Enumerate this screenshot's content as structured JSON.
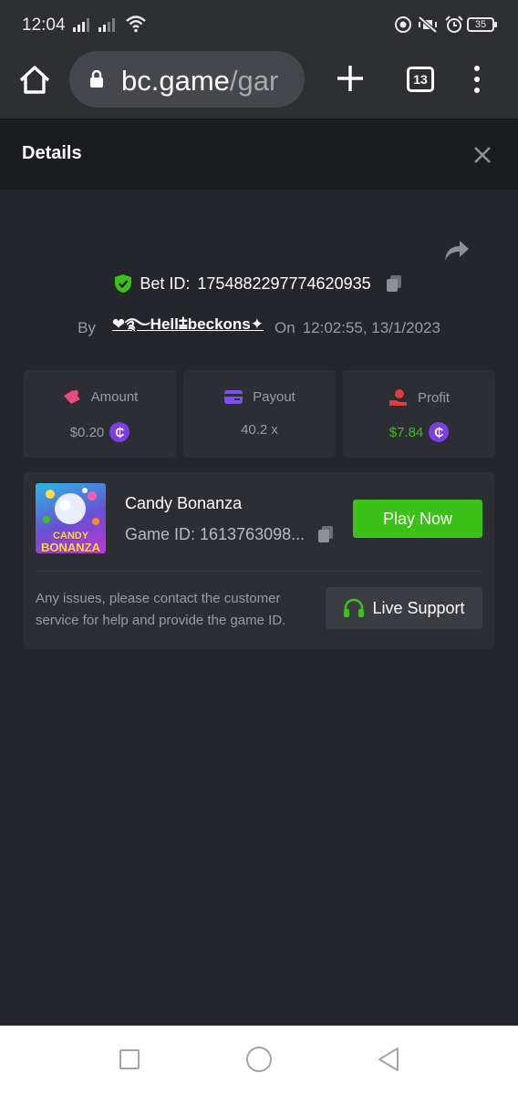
{
  "status_bar": {
    "time": "12:04",
    "battery": "35"
  },
  "browser": {
    "url_main": "bc.game",
    "url_rest": "/gar",
    "tab_count": "13"
  },
  "details": {
    "title": "Details"
  },
  "bet": {
    "id_label": "Bet ID:",
    "id_value": "1754882297774620935",
    "by_label": "By",
    "user": "❤࿐Hell⩲beckons✦",
    "on_label": "On",
    "datetime": "12:02:55, 13/1/2023"
  },
  "stats": {
    "amount_label": "Amount",
    "amount_value": "$0.20",
    "payout_label": "Payout",
    "payout_value": "40.2 x",
    "profit_label": "Profit",
    "profit_value": "$7.84",
    "coin_symbol": "₵"
  },
  "game": {
    "name": "Candy Bonanza",
    "thumb_line1": "CANDY",
    "thumb_line2": "BONANZA",
    "id_text": "Game ID: 1613763098...",
    "play_label": "Play Now",
    "help_text": "Any issues, please contact the customer service for help and provide the game ID.",
    "support_label": "Live Support"
  },
  "colors": {
    "accent_green": "#3bc117",
    "coin_purple": "#7b3fe4",
    "amount_pink": "#e84c7c",
    "payout_purple": "#7b4ff0",
    "profit_red": "#e23b3b"
  }
}
